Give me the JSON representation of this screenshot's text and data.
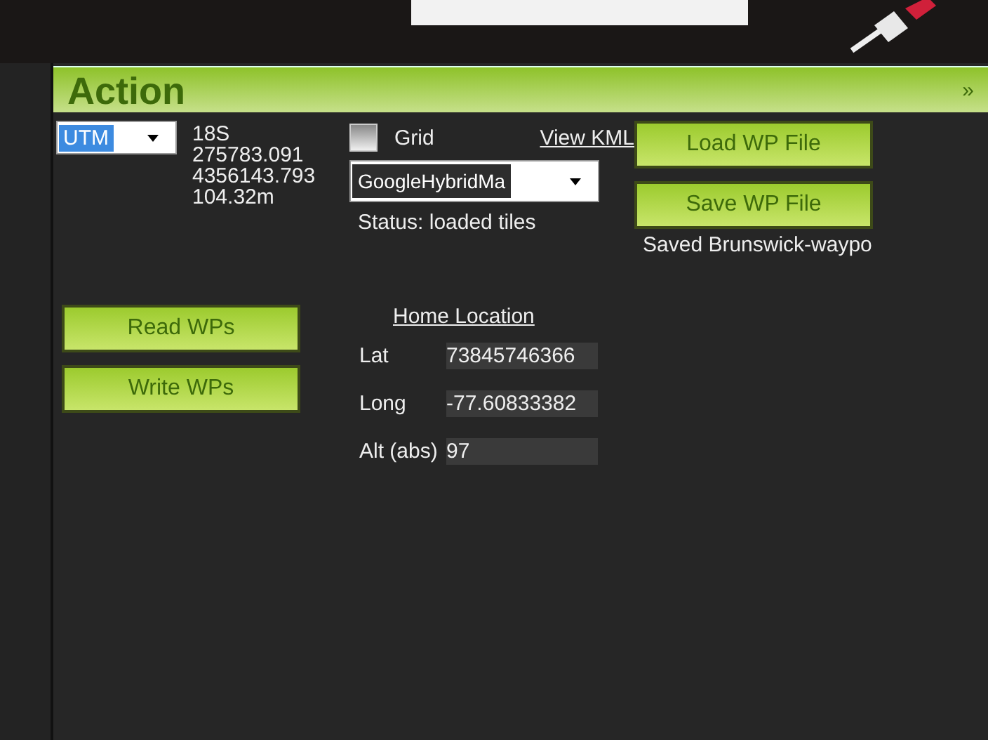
{
  "panel": {
    "title": "Action",
    "collapse_glyph": "»"
  },
  "coordinates": {
    "system": "UTM",
    "zone": "18S",
    "easting": "275783.091",
    "northing": "4356143.793",
    "altitude": "104.32m"
  },
  "grid": {
    "label": "Grid",
    "checked": false
  },
  "view_kml": "View KML",
  "map_type": "GoogleHybridMa",
  "status": "Status: loaded tiles",
  "file_buttons": [
    "Load WP File",
    "Save WP File"
  ],
  "saved_message": "Saved Brunswick-waypo",
  "wp_buttons": [
    "Read WPs",
    "Write WPs"
  ],
  "home_location": {
    "title": "Home Location",
    "fields": [
      {
        "label": "Lat",
        "value": "73845746366"
      },
      {
        "label": "Long",
        "value": "-77.60833382"
      },
      {
        "label": "Alt (abs)",
        "value": "97"
      }
    ]
  }
}
